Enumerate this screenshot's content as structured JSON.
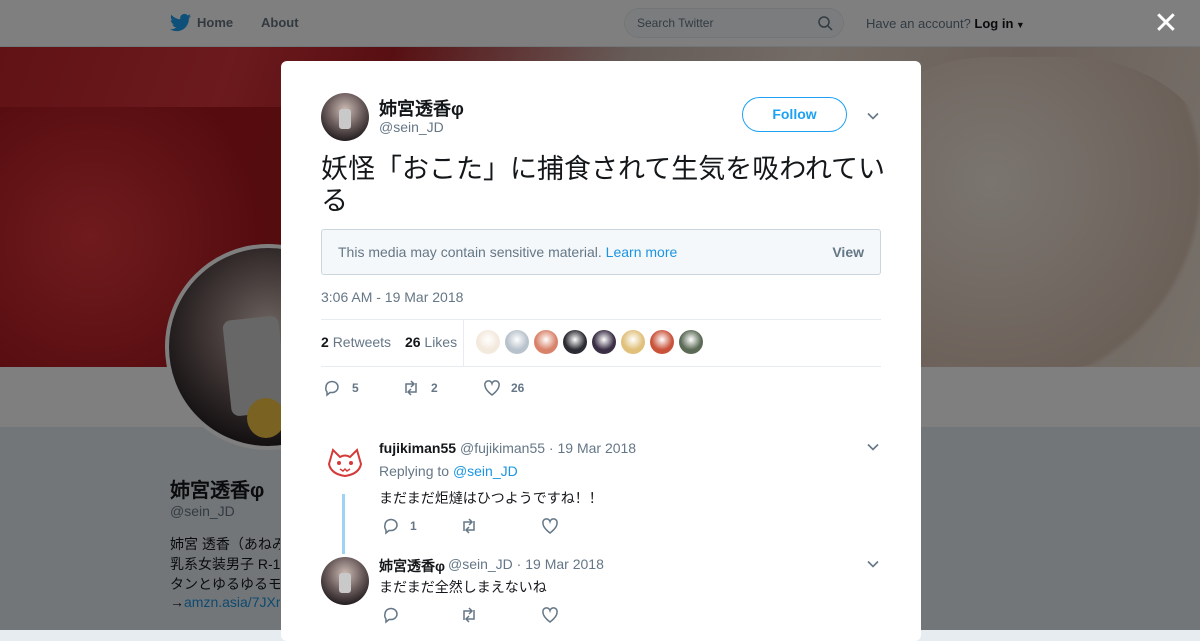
{
  "nav": {
    "home": "Home",
    "about": "About",
    "search_placeholder": "Search Twitter",
    "account_prompt": "Have an account?",
    "login": "Log in"
  },
  "profile_bg": {
    "name": "姉宮透香φ",
    "handle": "@sein_JD",
    "bio_lines": [
      "姉宮 透香（あねみ",
      "乳系女装男子 R-1",
      "タンとゆるゆるモ"
    ],
    "link": "amzn.asia/7JXr",
    "link_prefix": "→"
  },
  "tweet": {
    "author_name": "姉宮透香φ",
    "author_handle": "@sein_JD",
    "follow_label": "Follow",
    "text": "妖怪「おこた」に捕食されて生気を吸われている",
    "sensitive_msg": "This media may contain sensitive material.",
    "learn_more": "Learn more",
    "view_label": "View",
    "timestamp": "3:06 AM - 19 Mar 2018",
    "retweets_count": "2",
    "retweets_label": "Retweets",
    "likes_count": "26",
    "likes_label": "Likes",
    "actions": {
      "replies": "5",
      "retweets": "2",
      "likes": "26"
    },
    "liker_avatar_colors": [
      "#f3e9dc",
      "#b8c2cc",
      "#d9826a",
      "#2b2b33",
      "#3a2f45",
      "#e0c07a",
      "#c9533a",
      "#5b6a55"
    ]
  },
  "replies": [
    {
      "name": "fujikiman55",
      "handle": "@fujikiman55",
      "date": "19 Mar 2018",
      "replying_to_label": "Replying to",
      "replying_to": "@sein_JD",
      "text": "まだまだ炬燵はひつようですね！！",
      "reply_count": "1"
    },
    {
      "name": "姉宮透香φ",
      "handle": "@sein_JD",
      "date": "19 Mar 2018",
      "text": "まだまだ全然しまえないね"
    }
  ],
  "colors": {
    "accent": "#1da1f2",
    "link": "#1b95e0",
    "muted": "#657786"
  }
}
